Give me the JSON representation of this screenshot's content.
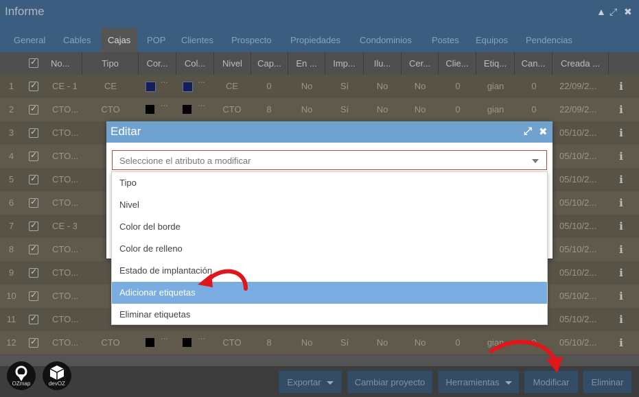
{
  "window": {
    "title": "Informe"
  },
  "tabs": [
    "General",
    "Cables",
    "Cajas",
    "POP",
    "Clientes",
    "Prospecto",
    "Propiedades",
    "Condominios",
    "Postes",
    "Equipos",
    "Pendencias"
  ],
  "active_tab": "Cajas",
  "columns": [
    "No...",
    "Tipo",
    "Cor...",
    "Col...",
    "Nivel",
    "Cap...",
    "En ...",
    "Imp...",
    "Ilu...",
    "Cer...",
    "Clie...",
    "Etiq...",
    "Can...",
    "Creada ..."
  ],
  "rows": [
    {
      "n": "1",
      "name": "CE - 1",
      "tipo": "CE",
      "c1": "#12205a",
      "c2": "#12205a",
      "nivel": "CE",
      "cap": "0",
      "en": "No",
      "imp": "Sí",
      "ilu": "No",
      "cer": "No",
      "clie": "0",
      "etiq": "gian",
      "can": "0",
      "creada": "22/09/2..."
    },
    {
      "n": "2",
      "name": "CTO...",
      "tipo": "CTO",
      "c1": "#000000",
      "c2": "#000000",
      "nivel": "CTO",
      "cap": "8",
      "en": "No",
      "imp": "Sí",
      "ilu": "No",
      "cer": "No",
      "clie": "0",
      "etiq": "gian",
      "can": "0",
      "creada": "22/09/2..."
    },
    {
      "n": "3",
      "name": "CTO...",
      "creada": "05/10/2..."
    },
    {
      "n": "4",
      "name": "CTO...",
      "creada": "05/10/2..."
    },
    {
      "n": "5",
      "name": "CTO...",
      "creada": "05/10/2..."
    },
    {
      "n": "6",
      "name": "CTO...",
      "creada": "05/10/2..."
    },
    {
      "n": "7",
      "name": "CE - 3",
      "creada": "05/10/2..."
    },
    {
      "n": "8",
      "name": "CTO...",
      "creada": "05/10/2..."
    },
    {
      "n": "9",
      "name": "CTO...",
      "creada": "05/10/2..."
    },
    {
      "n": "10",
      "name": "CTO...",
      "creada": "05/10/2..."
    },
    {
      "n": "11",
      "name": "CTO...",
      "creada": "05/10/2..."
    },
    {
      "n": "12",
      "name": "CTO...",
      "tipo": "CTO",
      "c1": "#000000",
      "c2": "#000000",
      "nivel": "CTO",
      "cap": "8",
      "en": "No",
      "imp": "Sí",
      "ilu": "No",
      "cer": "No",
      "clie": "0",
      "etiq": "gian",
      "can": "0",
      "creada": "05/10/2..."
    }
  ],
  "buttons": {
    "exportar": "Exportar",
    "cambiar": "Cambiar proyecto",
    "herramientas": "Herramientas",
    "modificar": "Modificar",
    "eliminar": "Eliminar"
  },
  "logos": {
    "ozmap": "OZmap",
    "devoz": "devOZ"
  },
  "dialog": {
    "title": "Editar",
    "select_placeholder": "Seleccione el atributo a modificar",
    "options": [
      "Tipo",
      "Nivel",
      "Color del borde",
      "Color de relleno",
      "Estado de implantación",
      "Adicionar etiquetas",
      "Eliminar etiquetas"
    ],
    "highlighted_option": "Adicionar etiquetas"
  },
  "colors": {
    "accent": "#6fa2cf",
    "highlight": "#79ace0",
    "annotation": "#e0161b"
  }
}
